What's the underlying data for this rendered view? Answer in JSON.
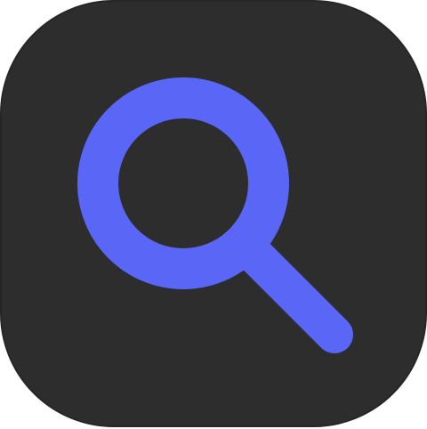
{
  "app_icon": {
    "name": "search",
    "icon": "search-icon",
    "colors": {
      "tile_background": "#2d2d2d",
      "glyph": "#5a67f6"
    }
  }
}
